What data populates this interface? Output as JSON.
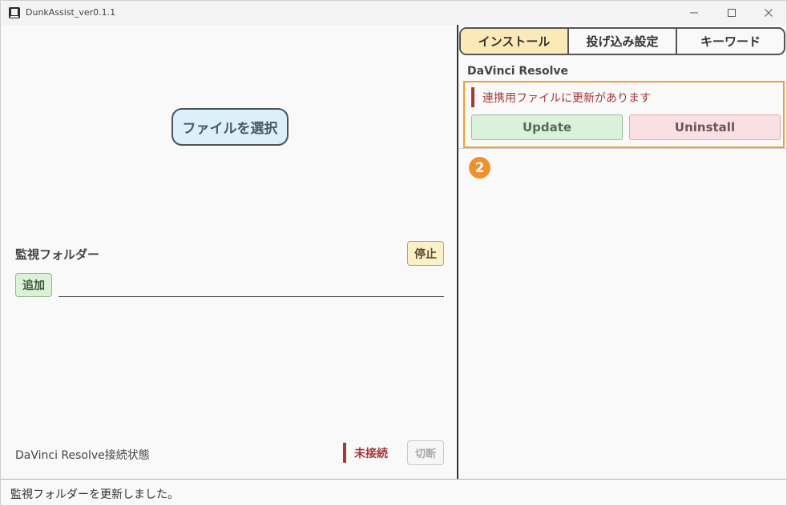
{
  "window": {
    "title": "DunkAssist_ver0.1.1",
    "controls": {
      "minimize": "—",
      "maximize": "☐",
      "close": "✕"
    }
  },
  "left": {
    "select_file_label": "ファイルを選択",
    "watch_folder_label": "監視フォルダー",
    "stop_label": "停止",
    "add_label": "追加",
    "folder_value": "",
    "connection_label": "DaVinci Resolve接続状態",
    "connection_status": "未接続",
    "disconnect_label": "切断"
  },
  "tabs": [
    {
      "label": "インストール",
      "active": true
    },
    {
      "label": "投げ込み設定",
      "active": false
    },
    {
      "label": "キーワード",
      "active": false
    }
  ],
  "install": {
    "section_title": "DaVinci Resolve",
    "notice": "連携用ファイルに更新があります",
    "update_label": "Update",
    "uninstall_label": "Uninstall",
    "marker": "2"
  },
  "status": {
    "message": "監視フォルダーを更新しました。"
  },
  "colors": {
    "accent_highlight": "#f0a030",
    "danger": "#a33a3a",
    "tab_active": "#fbeab7",
    "update_bg": "#dbf2da",
    "uninstall_bg": "#fbe0e3"
  }
}
